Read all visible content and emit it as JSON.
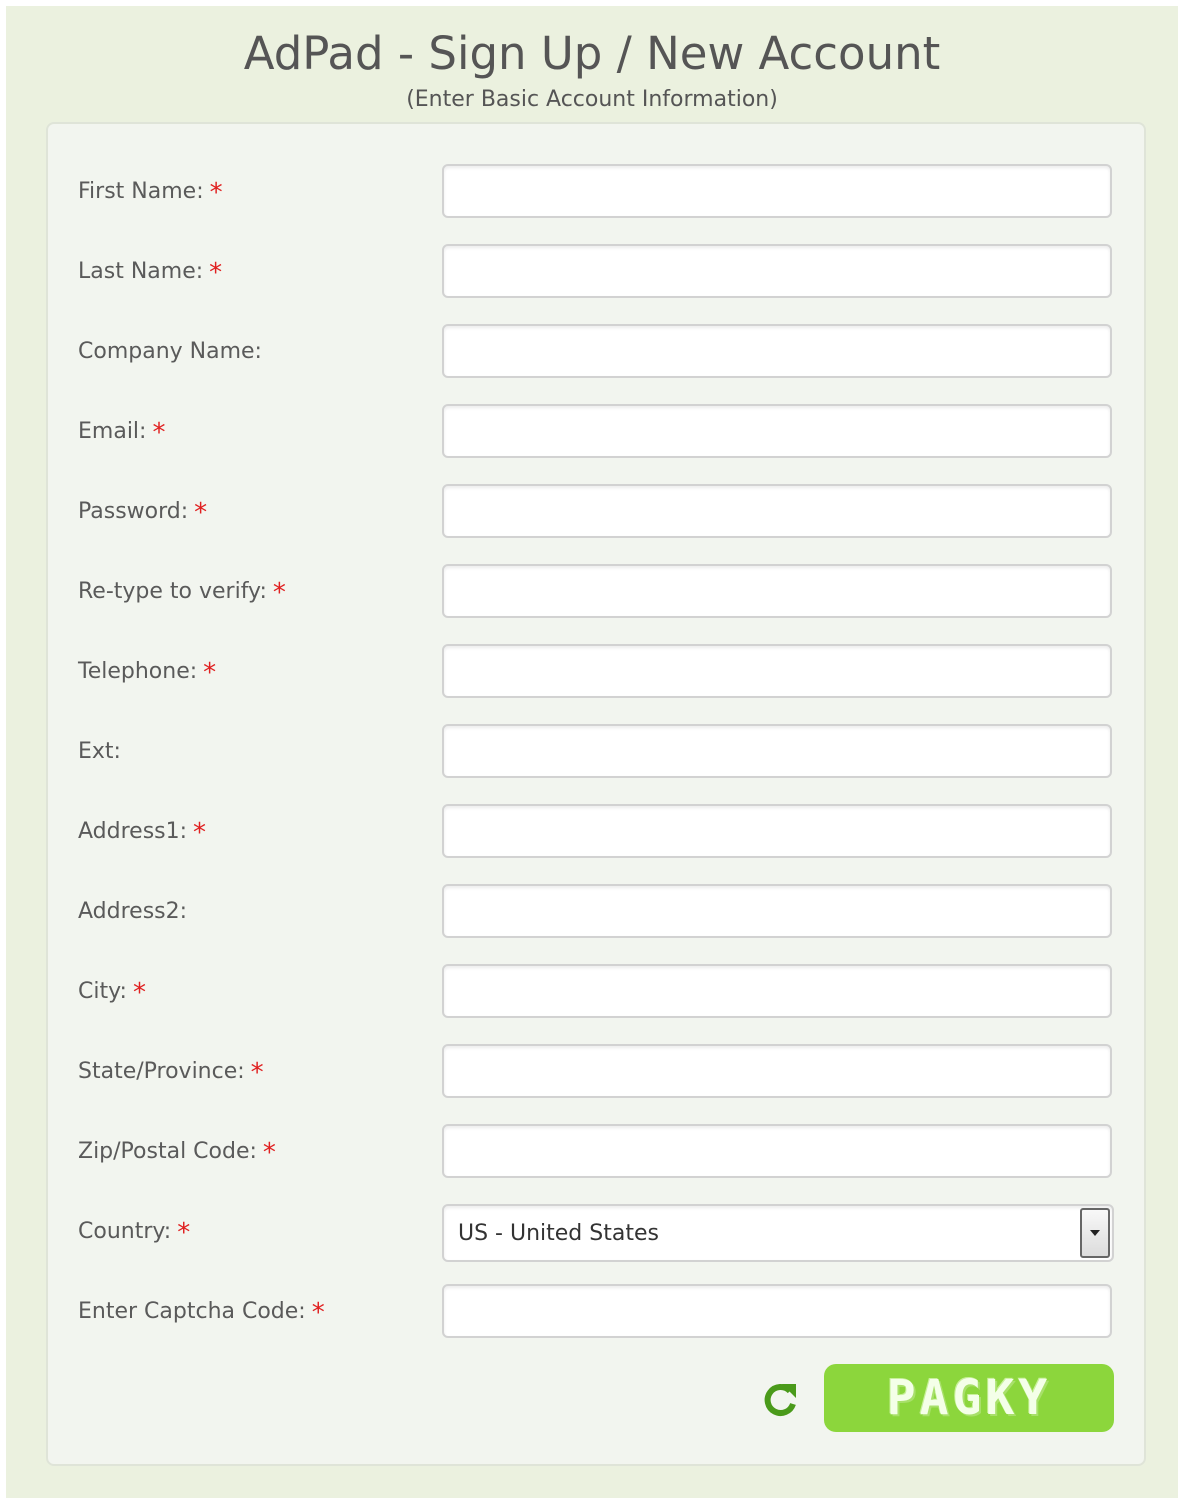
{
  "header": {
    "title": "AdPad - Sign Up / New Account",
    "subtitle": "(Enter Basic Account Information)"
  },
  "form": {
    "required_marker": "*",
    "fields": [
      {
        "label": "First Name:",
        "value": "",
        "required": true
      },
      {
        "label": "Last Name:",
        "value": "",
        "required": true
      },
      {
        "label": "Company Name:",
        "value": "",
        "required": false
      },
      {
        "label": "Email:",
        "value": "",
        "required": true
      },
      {
        "label": "Password:",
        "value": "",
        "required": true
      },
      {
        "label": "Re-type to verify:",
        "value": "",
        "required": true
      },
      {
        "label": "Telephone:",
        "value": "",
        "required": true
      },
      {
        "label": "Ext:",
        "value": "",
        "required": false
      },
      {
        "label": "Address1:",
        "value": "",
        "required": true
      },
      {
        "label": "Address2:",
        "value": "",
        "required": false
      },
      {
        "label": "City:",
        "value": "",
        "required": true
      },
      {
        "label": "State/Province:",
        "value": "",
        "required": true
      },
      {
        "label": "Zip/Postal Code:",
        "value": "",
        "required": true
      }
    ],
    "country": {
      "label": "Country:",
      "selected": "US - United States",
      "required": true
    },
    "captcha_field": {
      "label": "Enter Captcha Code:",
      "value": "",
      "required": true
    }
  },
  "captcha": {
    "image_text": "PAGKY",
    "refresh_icon": "refresh-icon",
    "background_color": "#8cd63c"
  },
  "colors": {
    "page_background": "#ebf1df",
    "panel_background": "#f2f5ef",
    "required": "#e02020",
    "refresh_icon": "#4a9a1a"
  }
}
